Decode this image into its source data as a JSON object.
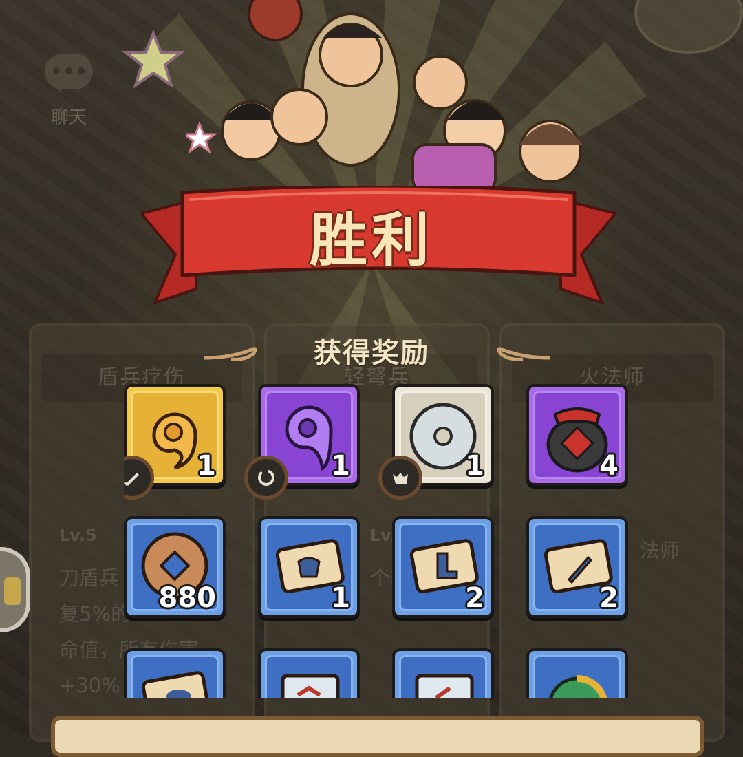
{
  "chat": {
    "label": "聊天"
  },
  "banner": {
    "title": "胜利"
  },
  "rewards": {
    "title": "获得奖励"
  },
  "panels": {
    "left": {
      "title": "盾兵疗伤",
      "level": "Lv.5",
      "desc_lines": [
        "刀盾兵",
        "复5%的",
        "命值，所有伤害",
        "+30%"
      ]
    },
    "middle": {
      "title": "轻弩兵",
      "level": "Lv.1",
      "desc": "个轻"
    },
    "right": {
      "title": "火法师",
      "desc": "法师"
    }
  },
  "items": [
    {
      "icon": "gold-magatama-icon",
      "quality": "gold",
      "count": "1",
      "badge_icon": "sword-badge-icon"
    },
    {
      "icon": "purple-magatama-icon",
      "quality": "purple",
      "count": "1",
      "badge_icon": "swirl-badge-icon"
    },
    {
      "icon": "jade-disc-icon",
      "quality": "white",
      "count": "1",
      "badge_icon": "beast-badge-icon"
    },
    {
      "icon": "wine-jar-icon",
      "quality": "purple",
      "count": "4"
    },
    {
      "icon": "copper-coin-icon",
      "quality": "blue",
      "count": "880"
    },
    {
      "icon": "armor-scroll-icon",
      "quality": "blue",
      "count": "1"
    },
    {
      "icon": "boots-scroll-icon",
      "quality": "blue",
      "count": "2"
    },
    {
      "icon": "sword-scroll-icon",
      "quality": "blue",
      "count": "2"
    },
    {
      "icon": "scroll-icon",
      "quality": "blue",
      "count": ""
    },
    {
      "icon": "map-scroll-icon",
      "quality": "blue",
      "count": ""
    },
    {
      "icon": "map-scroll-icon",
      "quality": "blue",
      "count": ""
    },
    {
      "icon": "green-orb-icon",
      "quality": "blue",
      "count": ""
    }
  ]
}
